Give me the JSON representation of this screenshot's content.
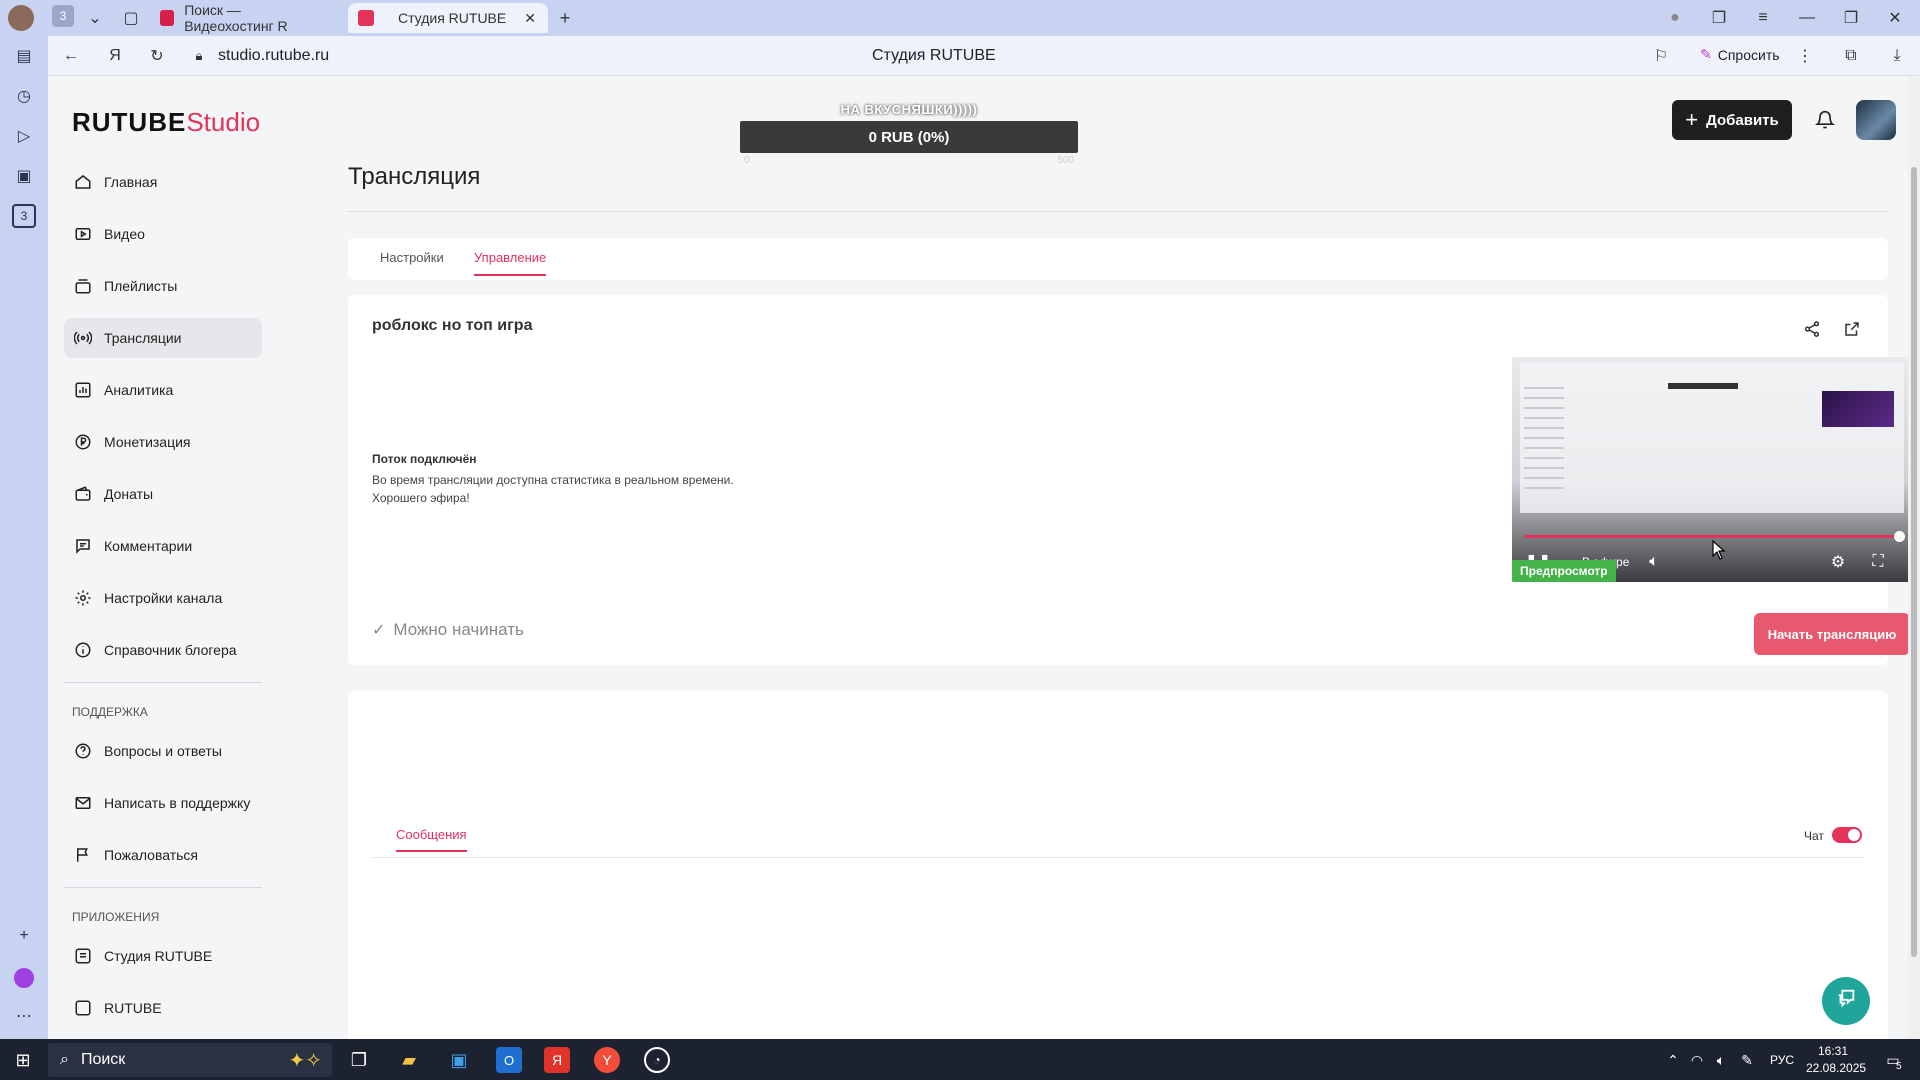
{
  "browser": {
    "tabs": [
      {
        "label": "Поиск — Видеохостинг R"
      },
      {
        "label": "Студия RUTUBE"
      }
    ],
    "tab_count_badge": "3",
    "url": "studio.rutube.ru",
    "page_title": "Студия RUTUBE",
    "ask_label": "Спросить",
    "sidebar_badge": "3"
  },
  "app": {
    "logo_main": "RUTUBE",
    "logo_sub": "Studio",
    "add_button": "Добавить"
  },
  "donation": {
    "title": "НА ВКУСНЯШКИ)))))",
    "amount": "0 RUB (0%)",
    "min": "0",
    "max": "500"
  },
  "sidebar": {
    "items": [
      {
        "label": "Главная",
        "icon": "home-icon"
      },
      {
        "label": "Видео",
        "icon": "video-icon"
      },
      {
        "label": "Плейлисты",
        "icon": "playlist-icon"
      },
      {
        "label": "Трансляции",
        "icon": "broadcast-icon"
      },
      {
        "label": "Аналитика",
        "icon": "analytics-icon"
      },
      {
        "label": "Монетизация",
        "icon": "ruble-icon"
      },
      {
        "label": "Донаты",
        "icon": "wallet-icon"
      },
      {
        "label": "Комментарии",
        "icon": "comment-icon"
      },
      {
        "label": "Настройки канала",
        "icon": "gear-icon"
      },
      {
        "label": "Справочник блогера",
        "icon": "info-icon"
      }
    ],
    "support_heading": "ПОДДЕРЖКА",
    "support_items": [
      {
        "label": "Вопросы и ответы",
        "icon": "question-icon"
      },
      {
        "label": "Написать в поддержку",
        "icon": "mail-icon"
      },
      {
        "label": "Пожаловаться",
        "icon": "flag-icon"
      }
    ],
    "apps_heading": "ПРИЛОЖЕНИЯ",
    "apps_items": [
      {
        "label": "Студия RUTUBE",
        "icon": "studio-icon"
      },
      {
        "label": "RUTUBE",
        "icon": "rutube-icon"
      }
    ]
  },
  "main": {
    "title": "Трансляция",
    "tabs": [
      {
        "label": "Настройки"
      },
      {
        "label": "Управление"
      }
    ],
    "stream_name": "роблокс но топ игра",
    "status_title": "Поток подключён",
    "status_line1": "Во время трансляции доступна статистика в реальном времени.",
    "status_line2": "Хорошего эфира!",
    "ready_label": "Можно начинать",
    "preview_badge": "Предпросмотр",
    "preview_live": "В эфире",
    "start_button": "Начать трансляцию",
    "preview_progress": 0.98
  },
  "chat": {
    "tab_label": "Сообщения",
    "toggle_label": "Чат",
    "toggle_on": true
  },
  "taskbar": {
    "search_label": "Поиск",
    "lang": "РУС",
    "time": "16:31",
    "date": "22.08.2025",
    "notif_count": "5"
  },
  "colors": {
    "accent": "#e2335b",
    "start_button": "#e8596f",
    "preview_badge": "#43b34a",
    "help_button": "#20a59a"
  }
}
